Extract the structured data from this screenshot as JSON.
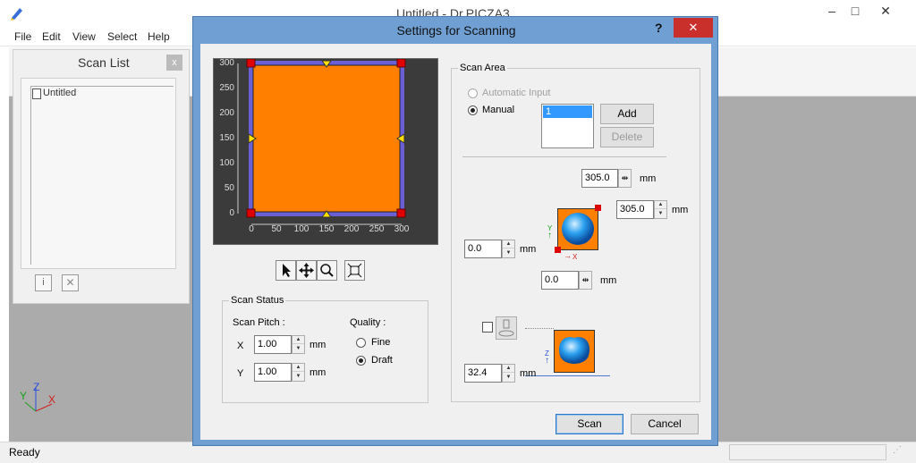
{
  "app": {
    "window_title": "Untitled - Dr.PICZA3",
    "menu": [
      "File",
      "Edit",
      "View",
      "Select",
      "Help"
    ],
    "status": "Ready"
  },
  "scan_list": {
    "title": "Scan List",
    "items": [
      "Untitled"
    ]
  },
  "dialog": {
    "title": "Settings for Scanning",
    "help": "?",
    "scan_area": {
      "title": "Scan Area",
      "automatic_label": "Automatic Input",
      "manual_label": "Manual",
      "selected_mode": "Manual",
      "list_items": [
        "1"
      ],
      "add_label": "Add",
      "delete_label": "Delete",
      "width_value": "305.0",
      "depth_value": "305.0",
      "x_value": "0.0",
      "y_value": "0.0",
      "z_checkbox_checked": false,
      "z_value": "32.4",
      "unit": "mm",
      "axis_x": "X",
      "axis_y": "Y",
      "axis_z": "Z"
    },
    "preview": {
      "y_ticks": [
        "300",
        "250",
        "200",
        "150",
        "100",
        "50",
        "0"
      ],
      "x_ticks": [
        "0",
        "50",
        "100",
        "150",
        "200",
        "250",
        "300"
      ],
      "area_color": "#ff8000",
      "border_color": "#6b5fd6"
    },
    "scan_status": {
      "title": "Scan Status",
      "pitch_label": "Scan Pitch :",
      "x_label": "X",
      "y_label": "Y",
      "x_value": "1.00",
      "y_value": "1.00",
      "unit": "mm",
      "quality_label": "Quality :",
      "fine_label": "Fine",
      "draft_label": "Draft",
      "selected_quality": "Draft"
    },
    "scan_label": "Scan",
    "cancel_label": "Cancel"
  },
  "axis_gizmo": {
    "x": "X",
    "y": "Y",
    "z": "Z"
  }
}
